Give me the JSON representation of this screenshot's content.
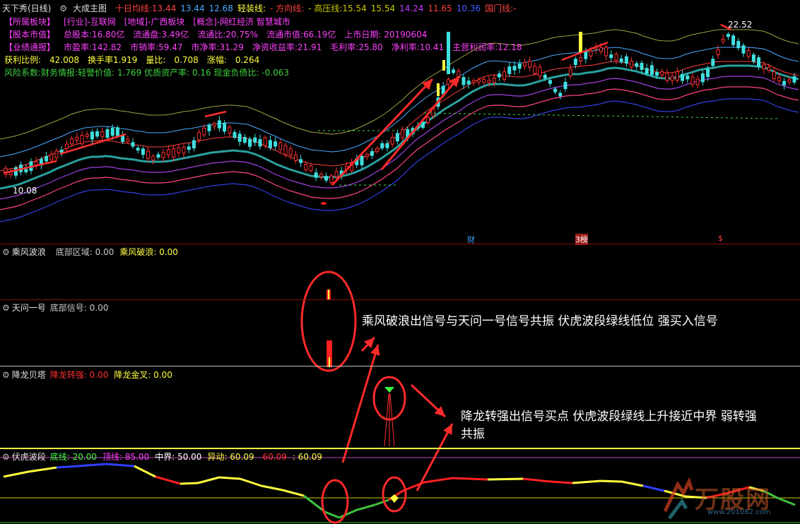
{
  "header": {
    "app_title": "天下秀(日线)",
    "main_chart_label": "大成主图",
    "indicators": [
      {
        "label": "十日均线:",
        "value": "13.44",
        "color": "#ff4040"
      },
      {
        "label": "",
        "value": "13.44",
        "color": "#4aa8ff"
      },
      {
        "label": "",
        "value": "12.68",
        "color": "#4aa8ff"
      },
      {
        "label": "轻装线:",
        "value": "",
        "color": "#ffff40"
      },
      {
        "label": "- 方向线:",
        "value": "",
        "color": "#ff4040"
      },
      {
        "label": "- 高压线:",
        "value": "15.54",
        "color": "#c8c800"
      },
      {
        "label": "",
        "value": "15.54",
        "color": "#c8c800"
      },
      {
        "label": "",
        "value": "14.24",
        "color": "#c040ff"
      },
      {
        "label": "",
        "value": "11.65",
        "color": "#ff4040"
      },
      {
        "label": "",
        "value": "10.36",
        "color": "#4060ff"
      },
      {
        "label": "国门线:",
        "value": "-",
        "color": "#ff4040"
      }
    ]
  },
  "info": {
    "row1": [
      "【所属板块】",
      "[行业]-互联网",
      "[地域]-广西板块",
      "[概念]-网红经济 智慧城市"
    ],
    "row2": [
      "【股本市值】",
      "总股本:16.80亿",
      "流通盘:3.49亿",
      "流通比:20.75%",
      "流通市值:66.19亿",
      "上市日期: 20190604"
    ],
    "row3": [
      "【业绩通报】",
      "市盈率:142.82",
      "市销率:59.47",
      "市净率:31.29",
      "净资收益率:21.91",
      "毛利率:25.80",
      "净利率:10.41",
      "主营利润率:12.18"
    ],
    "row4": [
      "获利比例:",
      "42.008",
      "换手率1.919",
      "量比:",
      "0.708",
      "涨幅:",
      "0.264"
    ],
    "row5": "风险系数:财务情报:轻警价值: 1.769 优质资产率: 0.16 现金负债比: -0.063"
  },
  "price_labels": {
    "high": "22.52",
    "low": "10.08"
  },
  "event_marks": [
    "财",
    "3榜",
    "$"
  ],
  "panels": {
    "p1": {
      "name": "乘风波浪",
      "items": [
        {
          "label": "底部区域:",
          "value": "0.00",
          "color": "#c8c8c8"
        },
        {
          "label": "乘风破浪:",
          "value": "0.00",
          "color": "#ffff40"
        }
      ]
    },
    "p2": {
      "name": "天问一号",
      "items": [
        {
          "label": "底部信号:",
          "value": "0.00",
          "color": "#c8c8c8"
        }
      ]
    },
    "p3": {
      "name": "降龙贝塔",
      "items": [
        {
          "label": "降龙转强:",
          "value": "0.00",
          "color": "#ff3030"
        },
        {
          "label": "降龙金叉:",
          "value": "0.00",
          "color": "#ffff40"
        }
      ]
    },
    "p4": {
      "name": "伏虎波段",
      "items": [
        {
          "label": "底线:",
          "value": "20.00",
          "color": "#40ff40"
        },
        {
          "label": "顶线:",
          "value": "85.00",
          "color": "#ff40ff"
        },
        {
          "label": "中界:",
          "value": "50.00",
          "color": "#ffffff"
        },
        {
          "label": "异动:",
          "value": "60.09",
          "color": "#ffff40"
        },
        {
          "label": "",
          "value": "60.09",
          "color": "#ff3030"
        },
        {
          "label": ":",
          "value": "60.09",
          "color": "#ffff40"
        }
      ]
    }
  },
  "annotations": {
    "a1": "乘风破浪出信号与天问一号信号共振 伏虎波段绿线低位 强买入信号",
    "a2_line1": "降龙转强出信号买点 伏虎波段绿线上升接近中界 弱转强",
    "a2_line2": "共振"
  },
  "logo": {
    "text": "万股网",
    "url_text": "www.201082.com"
  },
  "colors": {
    "up": "#ff3030",
    "down": "#40e0e0",
    "annot_red": "#ff2a2a"
  }
}
